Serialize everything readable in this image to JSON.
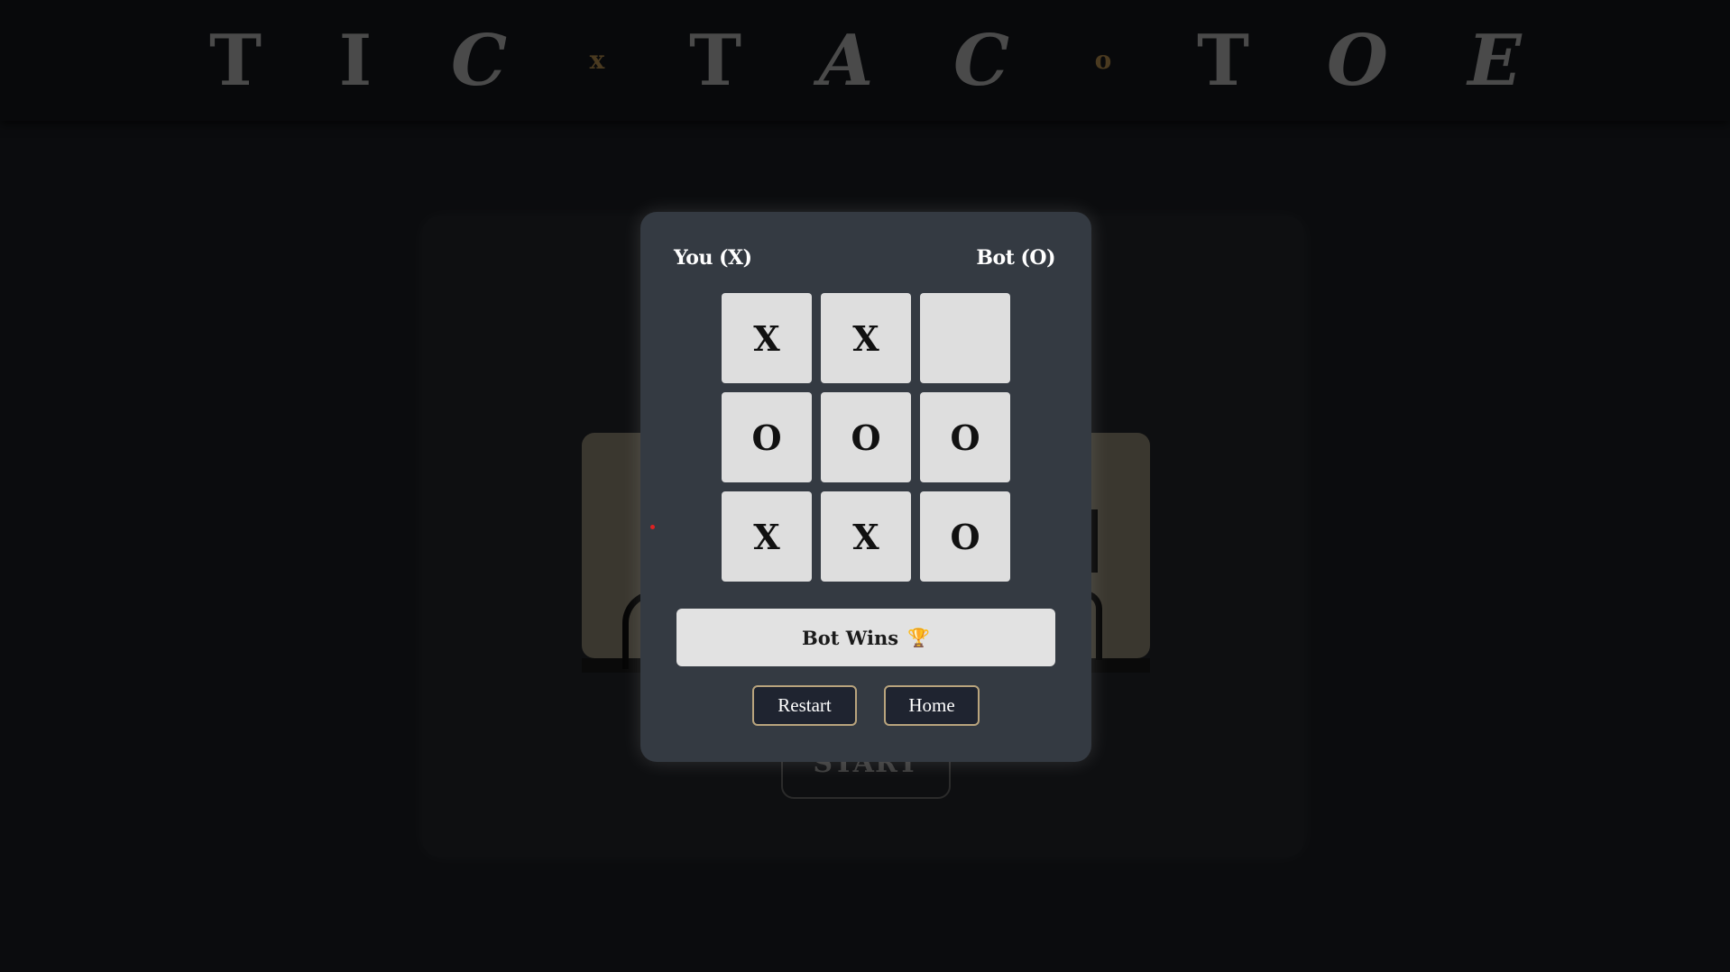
{
  "header": {
    "title_letters": [
      "T",
      "I",
      "C",
      "x",
      "T",
      "A",
      "C",
      "o",
      "T",
      "O",
      "E"
    ]
  },
  "background": {
    "start_label": "START"
  },
  "modal": {
    "player_you": "You (X)",
    "player_bot": "Bot (O)",
    "board": [
      "X",
      "X",
      "",
      "O",
      "O",
      "O",
      "X",
      "X",
      "O"
    ],
    "result_text": "Bot Wins",
    "result_icon": "trophy-icon",
    "restart_label": "Restart",
    "home_label": "Home"
  },
  "colors": {
    "modal_bg": "#343a42",
    "cell_bg": "#dedede",
    "button_border": "#b9a47d",
    "button_bg": "#1f2430"
  }
}
